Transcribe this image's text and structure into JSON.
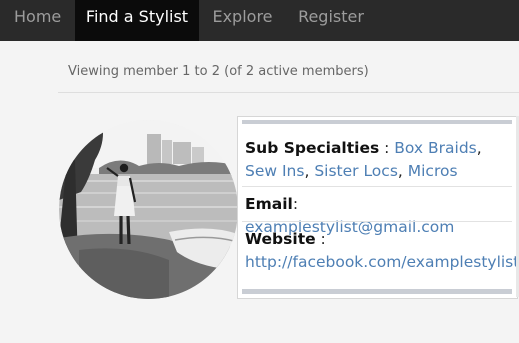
{
  "nav": {
    "home": "Home",
    "find_stylist": "Find a Stylist",
    "explore": "Explore",
    "register": "Register"
  },
  "members": {
    "count_text": "Viewing member 1 to 2 (of 2 active members)"
  },
  "card": {
    "sub_specialties_label": "Sub Specialties",
    "sub_specialties_sep": " : ",
    "specialties": [
      "Box Braids",
      "Sew Ins",
      "Sister Locs",
      "Micros"
    ],
    "email_label": "Email",
    "email_sep": ": ",
    "email_value": "examplestylist@gmail.com",
    "website_label": "Website",
    "website_sep": " :",
    "website_value": "http://facebook.com/examplestylist"
  },
  "colors": {
    "nav_bg": "#2a2a2a",
    "nav_active_bg": "#0b0b0b",
    "link": "#4e7fb4",
    "page_bg": "#f4f4f4"
  }
}
